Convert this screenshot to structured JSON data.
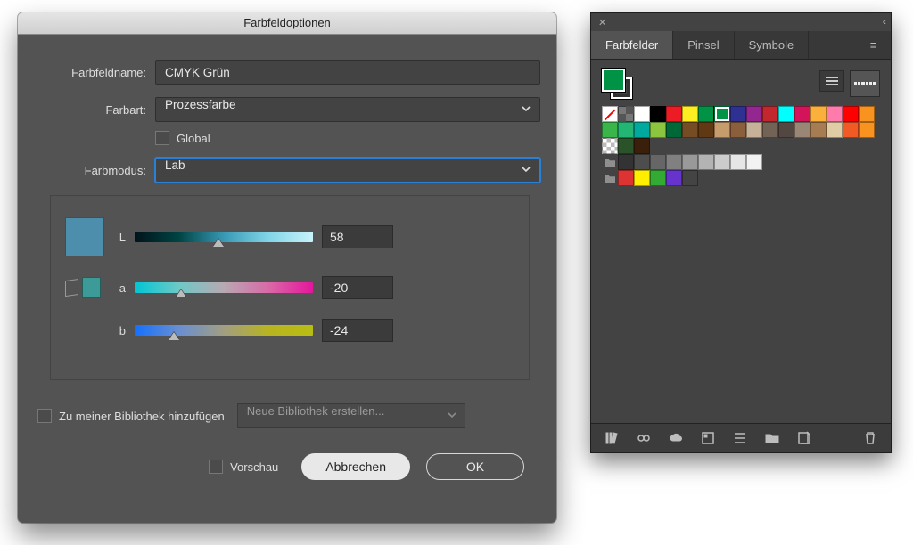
{
  "dialog": {
    "title": "Farbfeldoptionen",
    "name_label": "Farbfeldname:",
    "name_value": "CMYK Grün",
    "type_label": "Farbart:",
    "type_value": "Prozessfarbe",
    "global_label": "Global",
    "mode_label": "Farbmodus:",
    "mode_value": "Lab",
    "lab": {
      "L": {
        "label": "L",
        "value": "58",
        "pos_pct": 47
      },
      "a": {
        "label": "a",
        "value": "-20",
        "pos_pct": 26
      },
      "b": {
        "label": "b",
        "value": "-24",
        "pos_pct": 22
      }
    },
    "preview_color": "#4c8eab",
    "ref_color": "#3d9b97",
    "add_lib_label": "Zu meiner Bibliothek hinzufügen",
    "lib_select_label": "Neue Bibliothek erstellen...",
    "preview_toggle_label": "Vorschau",
    "cancel_label": "Abbrechen",
    "ok_label": "OK"
  },
  "panel": {
    "tabs": [
      "Farbfelder",
      "Pinsel",
      "Symbole"
    ],
    "active_tab": 0,
    "current_fill": "#009245",
    "rows": [
      [
        "none",
        "reg",
        "#ffffff",
        "#000000",
        "#ed1c24",
        "#fcee21",
        "#009245",
        "#009245 sel",
        "#2e3192",
        "#93278f",
        "#c1272d",
        "#00ffff",
        "#d4145a",
        "#fbb03b",
        "#ff7bac",
        "#ff0000",
        "#f7931e"
      ],
      [
        "#39b54a",
        "#22b573",
        "#00a99d",
        "#8cc63f",
        "#006837",
        "#754c24",
        "#603813",
        "#c69c6d",
        "#8b5e3c",
        "#c7b299",
        "#736357",
        "#534741",
        "#998675",
        "#a67c52",
        "#e0cda5",
        "#f15a24",
        "#f7931e"
      ],
      [
        "trans",
        "#2b5329",
        "#3a1f0b",
        "",
        "",
        "",
        "",
        "",
        "",
        "",
        "",
        "",
        "",
        "",
        "",
        "",
        ""
      ],
      [
        "folder",
        "#333333",
        "#4d4d4d",
        "#666666",
        "#808080",
        "#999999",
        "#b3b3b3",
        "#cccccc",
        "#e6e6e6",
        "#f2f2f2",
        "",
        "",
        "",
        "",
        "",
        "",
        ""
      ],
      [
        "folder",
        "#dd3333",
        "#ffee00",
        "#33aa33",
        "#6633cc",
        "#444444",
        "",
        "",
        "",
        "",
        "",
        "",
        "",
        "",
        "",
        "",
        ""
      ]
    ],
    "footer_icons": [
      "library-icon",
      "link-icon",
      "cloud-icon",
      "swatch-options-icon",
      "list-icon",
      "folder-icon",
      "new-swatch-icon",
      "trash-icon"
    ]
  }
}
